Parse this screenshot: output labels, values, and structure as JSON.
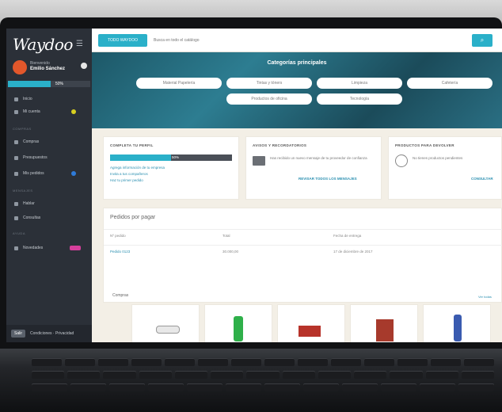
{
  "app": {
    "logo": "Waydoo"
  },
  "sidebar": {
    "user_greeting": "Bienvenido",
    "user_name": "Emilio Sánchez",
    "progress_label": "50%",
    "sections": [
      "COMPRAS",
      "MENSAJES",
      "AYUDA"
    ],
    "items": [
      {
        "label": "Inicio"
      },
      {
        "label": "Mi cuenta"
      },
      {
        "label": "Compras"
      },
      {
        "label": "Presupuestos"
      },
      {
        "label": "Mis pedidos"
      },
      {
        "label": "Hablar"
      },
      {
        "label": "Consultas"
      },
      {
        "label": "Novedades"
      }
    ],
    "footer": {
      "button": "Salir",
      "links": "Condiciones · Privacidad"
    }
  },
  "topbar": {
    "search_button": "TODO WAYDOO",
    "search_placeholder": "Busca en todo el catálogo",
    "search_go_icon": "search-icon"
  },
  "hero": {
    "title": "Categorías principales",
    "categories": [
      "Material Papelería",
      "Tintas y tóners",
      "Limpieza",
      "Cafetería",
      "Productos de oficina",
      "Tecnología"
    ]
  },
  "cards": {
    "profile": {
      "title": "COMPLETA TU PERFIL",
      "progress": "50%",
      "lines": [
        "Agrega información de tu empresa",
        "Invita a tus compañeros",
        "Haz tu primer pedido"
      ]
    },
    "messages": {
      "title": "AVISOS Y RECORDATORIOS",
      "text": "Has recibido un nuevo mensaje de tu proveedor de confianza",
      "link": "REVISAR TODOS LOS MENSAJES"
    },
    "returns": {
      "title": "PRODUCTOS PARA DEVOLVER",
      "text": "No tienes productos pendientes",
      "link": "CONSULTAR"
    }
  },
  "orders": {
    "title": "Pedidos por pagar",
    "headers": [
      "Nº pedido",
      "Total",
      "Fecha de entrega"
    ],
    "row": [
      "Pedido 0123",
      "30.000,00",
      "17 de diciembre de 2017"
    ]
  },
  "products": {
    "title": "Compras",
    "link": "Ver todas"
  }
}
